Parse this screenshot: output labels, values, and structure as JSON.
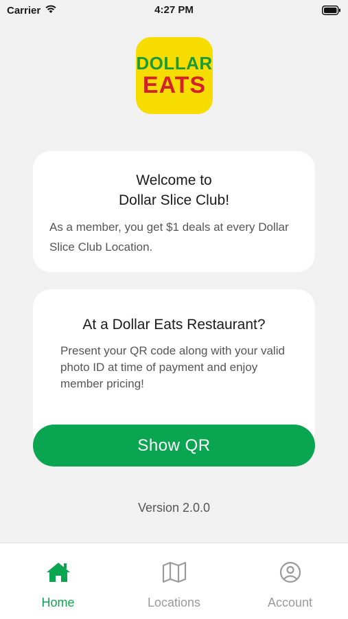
{
  "status_bar": {
    "carrier": "Carrier",
    "time": "4:27 PM",
    "icons": [
      "wifi-icon",
      "battery-icon"
    ]
  },
  "logo": {
    "line1": "DOLLAR",
    "line2": "EATS",
    "colors": {
      "background": "#f7dc00",
      "line1": "#1a9a3a",
      "line2": "#d4202a"
    }
  },
  "welcome_card": {
    "title_line1": "Welcome to",
    "title_line2": "Dollar Slice Club!",
    "body": "As a member, you get $1 deals at every Dollar Slice Club Location."
  },
  "restaurant_card": {
    "title": "At a Dollar Eats Restaurant?",
    "body": "Present your QR code along with your valid photo ID at time of payment and enjoy member pricing!"
  },
  "show_qr_button": {
    "label": "Show QR"
  },
  "version": "Version 2.0.0",
  "tab_bar": {
    "tabs": [
      {
        "label": "Home",
        "icon": "home-icon",
        "active": true
      },
      {
        "label": "Locations",
        "icon": "map-icon",
        "active": false
      },
      {
        "label": "Account",
        "icon": "user-circle-icon",
        "active": false
      }
    ]
  },
  "colors": {
    "accent": "#0aa550",
    "background": "#f1f1f1",
    "card": "#ffffff",
    "inactive": "#9a9a9a"
  }
}
